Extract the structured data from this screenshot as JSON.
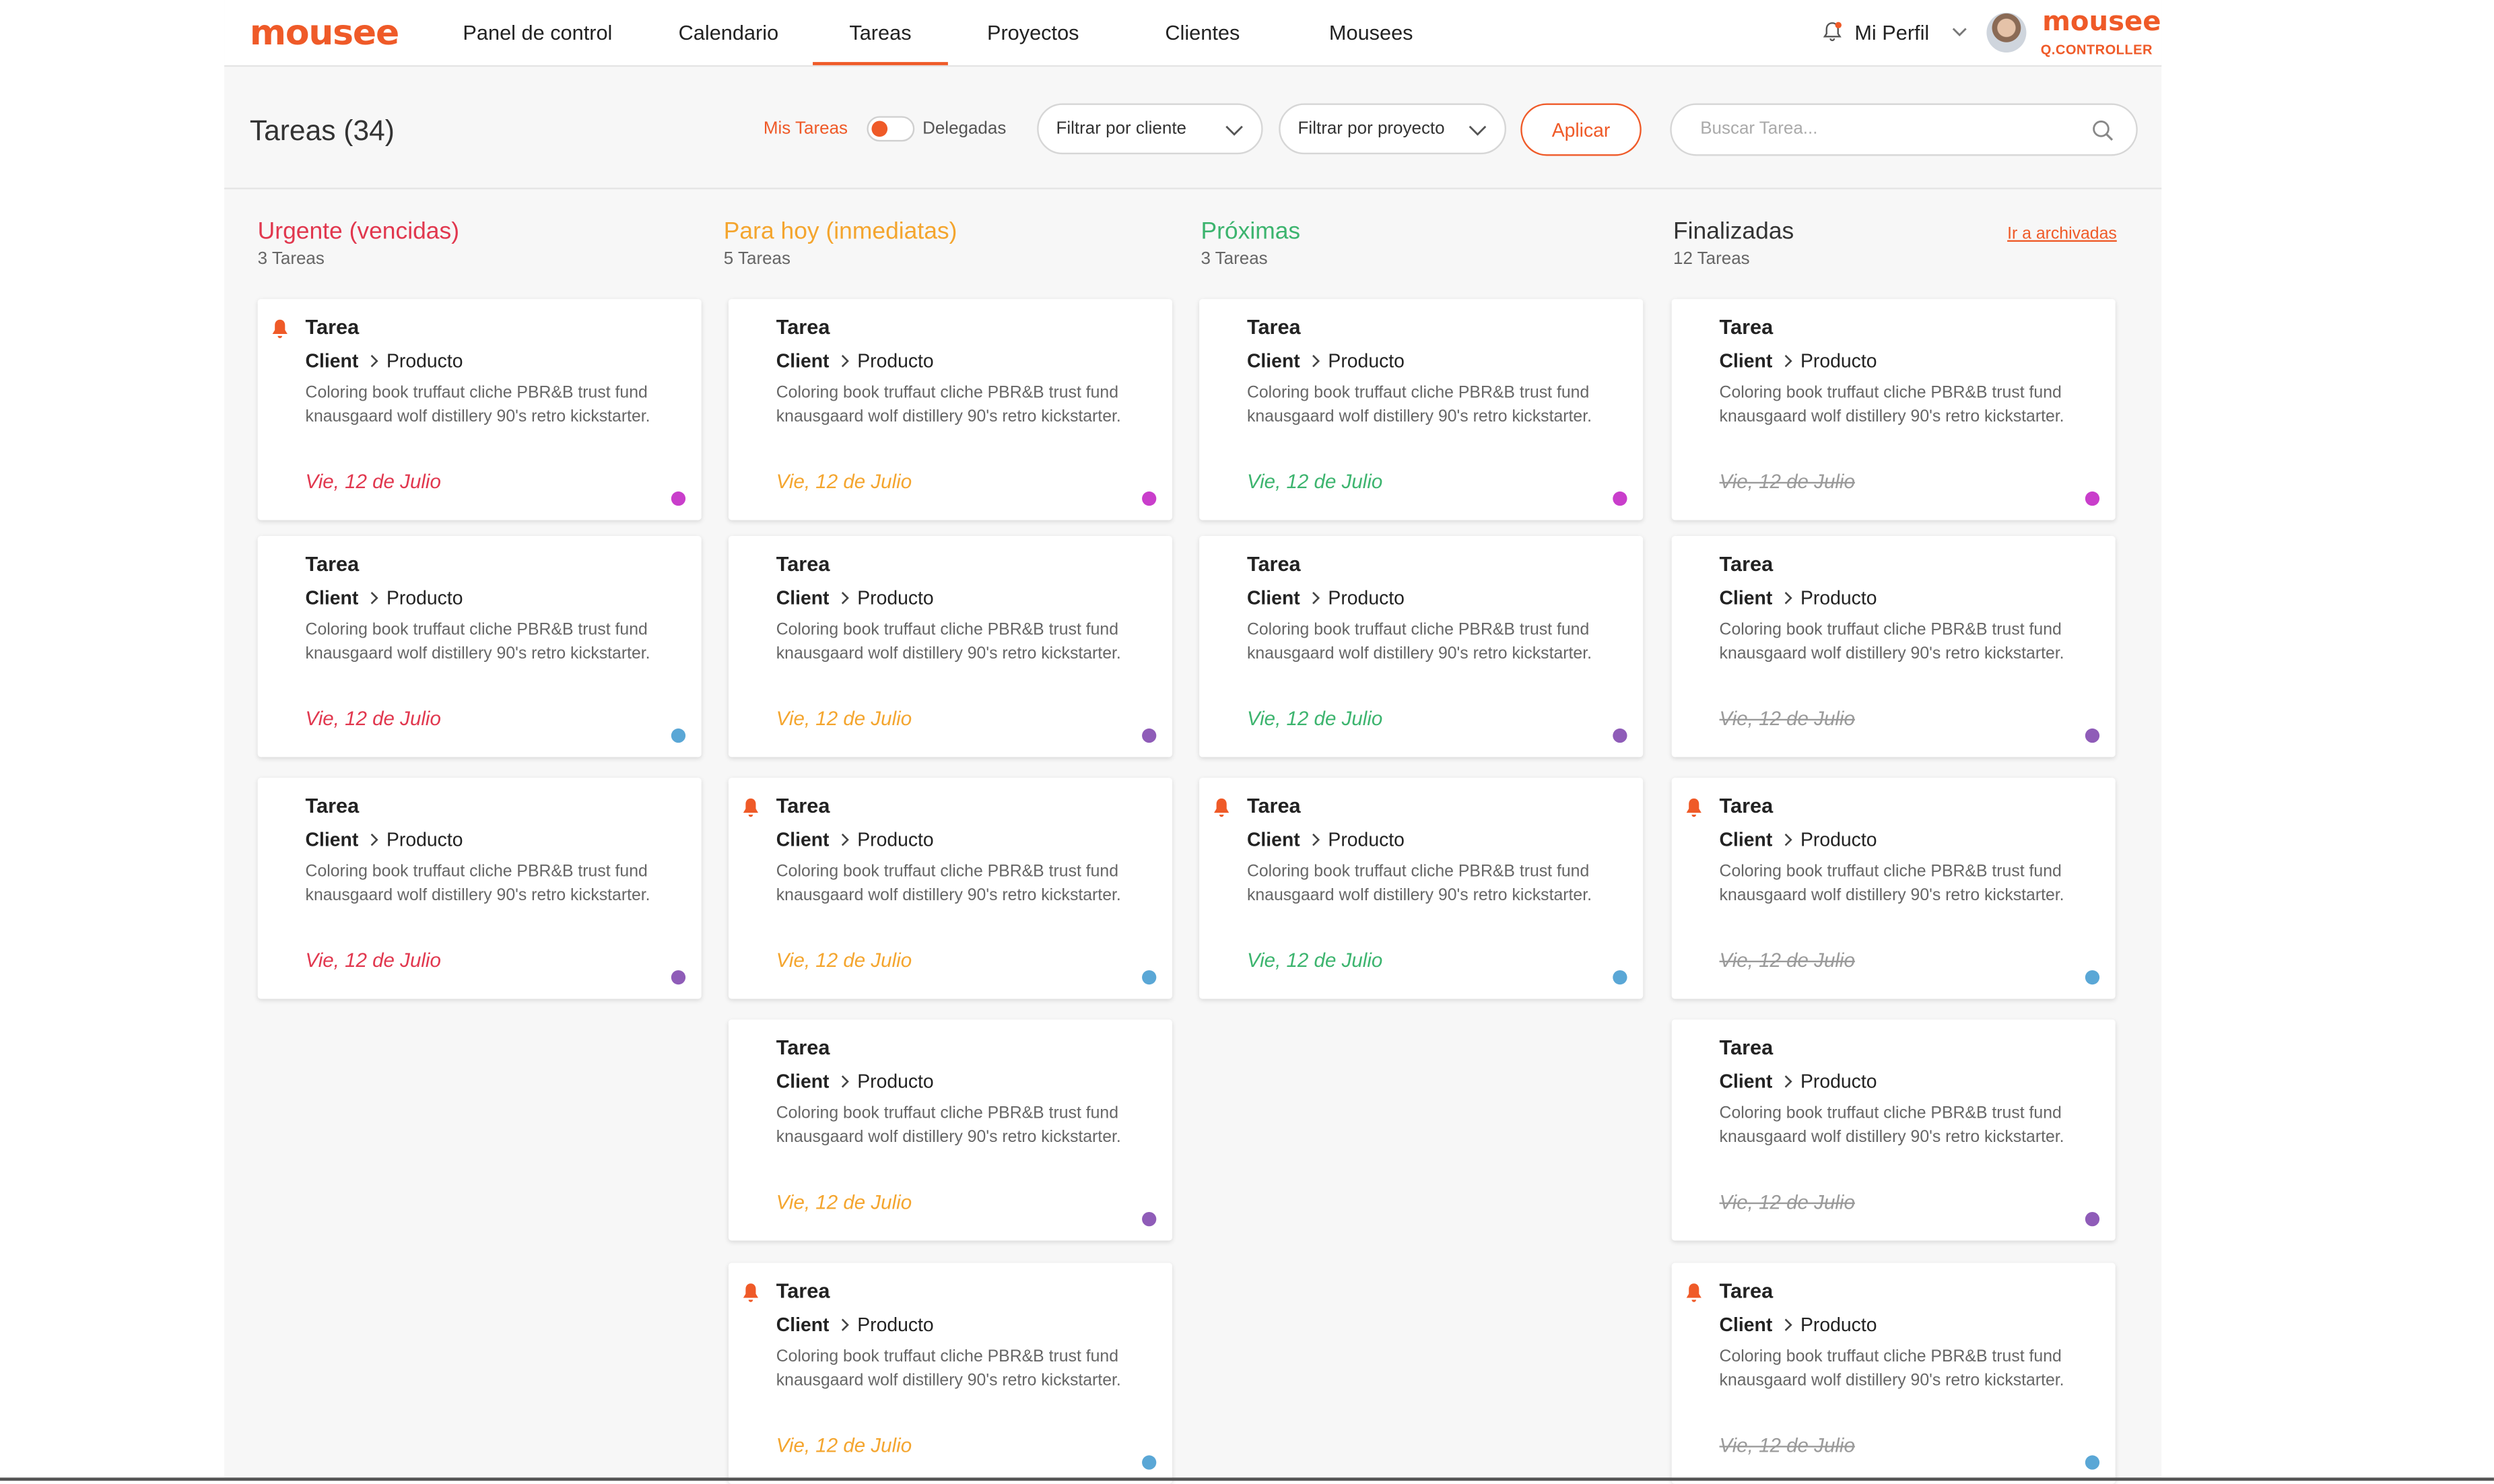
{
  "app": {
    "logo": "mousee",
    "brand_logo": "mousee",
    "brand_sub": "Q.CONTROLLER"
  },
  "nav": {
    "items": [
      "Panel de control",
      "Calendario",
      "Tareas",
      "Proyectos",
      "Clientes",
      "Mousees"
    ],
    "active_index": 2,
    "profile_label": "Mi Perfil"
  },
  "toolbar": {
    "title": "Tareas (34)",
    "mis_tareas": "Mis Tareas",
    "delegadas": "Delegadas",
    "filter_client": "Filtrar por cliente",
    "filter_project": "Filtrar por proyecto",
    "apply": "Aplicar",
    "search_placeholder": "Buscar Tarea..."
  },
  "colors": {
    "accent": "#ef5a28",
    "urgent": "#e1374e",
    "today": "#f4a52e",
    "next": "#3cb46e",
    "done": "#333333",
    "magenta": "#c93ecb",
    "purple": "#8f5cb8",
    "blue": "#5aa7d6"
  },
  "columns": [
    {
      "key": "urgent",
      "title": "Urgente (vencidas)",
      "count": "3 Tareas",
      "cards": [
        {
          "title": "Tarea",
          "client": "Client",
          "product": "Producto",
          "desc": "Coloring book truffaut cliche PBR&B trust fund knausgaard wolf distillery 90's retro kickstarter.",
          "date": "Vie, 12 de Julio",
          "alert": true,
          "dot": "magenta"
        },
        {
          "title": "Tarea",
          "client": "Client",
          "product": "Producto",
          "desc": "Coloring book truffaut cliche PBR&B trust fund knausgaard wolf distillery 90's retro kickstarter.",
          "date": "Vie, 12 de Julio",
          "alert": false,
          "dot": "blue"
        },
        {
          "title": "Tarea",
          "client": "Client",
          "product": "Producto",
          "desc": "Coloring book truffaut cliche PBR&B trust fund knausgaard wolf distillery 90's retro kickstarter.",
          "date": "Vie, 12 de Julio",
          "alert": false,
          "dot": "purple"
        }
      ]
    },
    {
      "key": "today",
      "title": "Para hoy (inmediatas)",
      "count": "5 Tareas",
      "cards": [
        {
          "title": "Tarea",
          "client": "Client",
          "product": "Producto",
          "desc": "Coloring book truffaut cliche PBR&B trust fund knausgaard wolf distillery 90's retro kickstarter.",
          "date": "Vie, 12 de Julio",
          "alert": false,
          "dot": "magenta"
        },
        {
          "title": "Tarea",
          "client": "Client",
          "product": "Producto",
          "desc": "Coloring book truffaut cliche PBR&B trust fund knausgaard wolf distillery 90's retro kickstarter.",
          "date": "Vie, 12 de Julio",
          "alert": false,
          "dot": "purple"
        },
        {
          "title": "Tarea",
          "client": "Client",
          "product": "Producto",
          "desc": "Coloring book truffaut cliche PBR&B trust fund knausgaard wolf distillery 90's retro kickstarter.",
          "date": "Vie, 12 de Julio",
          "alert": true,
          "dot": "blue"
        },
        {
          "title": "Tarea",
          "client": "Client",
          "product": "Producto",
          "desc": "Coloring book truffaut cliche PBR&B trust fund knausgaard wolf distillery 90's retro kickstarter.",
          "date": "Vie, 12 de Julio",
          "alert": false,
          "dot": "purple"
        },
        {
          "title": "Tarea",
          "client": "Client",
          "product": "Producto",
          "desc": "Coloring book truffaut cliche PBR&B trust fund knausgaard wolf distillery 90's retro kickstarter.",
          "date": "Vie, 12 de Julio",
          "alert": true,
          "dot": "blue"
        }
      ]
    },
    {
      "key": "next",
      "title": "Próximas",
      "count": "3 Tareas",
      "cards": [
        {
          "title": "Tarea",
          "client": "Client",
          "product": "Producto",
          "desc": "Coloring book truffaut cliche PBR&B trust fund knausgaard wolf distillery 90's retro kickstarter.",
          "date": "Vie, 12 de Julio",
          "alert": false,
          "dot": "magenta"
        },
        {
          "title": "Tarea",
          "client": "Client",
          "product": "Producto",
          "desc": "Coloring book truffaut cliche PBR&B trust fund knausgaard wolf distillery 90's retro kickstarter.",
          "date": "Vie, 12 de Julio",
          "alert": false,
          "dot": "purple"
        },
        {
          "title": "Tarea",
          "client": "Client",
          "product": "Producto",
          "desc": "Coloring book truffaut cliche PBR&B trust fund knausgaard wolf distillery 90's retro kickstarter.",
          "date": "Vie, 12 de Julio",
          "alert": true,
          "dot": "blue"
        }
      ]
    },
    {
      "key": "done",
      "title": "Finalizadas",
      "count": "12 Tareas",
      "link": "Ir a  archivadas",
      "cards": [
        {
          "title": "Tarea",
          "client": "Client",
          "product": "Producto",
          "desc": "Coloring book truffaut cliche PBR&B trust fund knausgaard wolf distillery 90's retro kickstarter.",
          "date": "Vie, 12 de Julio",
          "alert": false,
          "dot": "magenta"
        },
        {
          "title": "Tarea",
          "client": "Client",
          "product": "Producto",
          "desc": "Coloring book truffaut cliche PBR&B trust fund knausgaard wolf distillery 90's retro kickstarter.",
          "date": "Vie, 12 de Julio",
          "alert": false,
          "dot": "purple"
        },
        {
          "title": "Tarea",
          "client": "Client",
          "product": "Producto",
          "desc": "Coloring book truffaut cliche PBR&B trust fund knausgaard wolf distillery 90's retro kickstarter.",
          "date": "Vie, 12 de Julio",
          "alert": true,
          "dot": "blue"
        },
        {
          "title": "Tarea",
          "client": "Client",
          "product": "Producto",
          "desc": "Coloring book truffaut cliche PBR&B trust fund knausgaard wolf distillery 90's retro kickstarter.",
          "date": "Vie, 12 de Julio",
          "alert": false,
          "dot": "purple"
        },
        {
          "title": "Tarea",
          "client": "Client",
          "product": "Producto",
          "desc": "Coloring book truffaut cliche PBR&B trust fund knausgaard wolf distillery 90's retro kickstarter.",
          "date": "Vie, 12 de Julio",
          "alert": true,
          "dot": "blue"
        }
      ]
    }
  ]
}
